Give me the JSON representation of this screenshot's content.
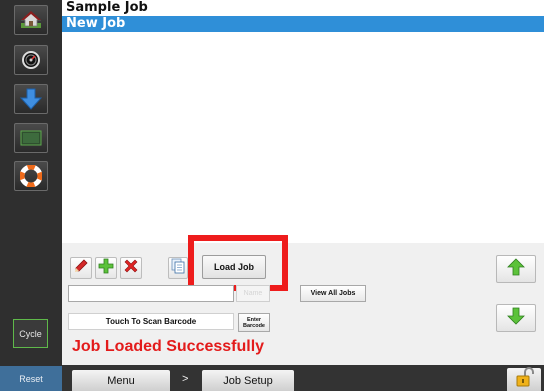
{
  "sidebar": {
    "items": [
      {
        "name": "home",
        "icon": "home-icon"
      },
      {
        "name": "dashboard",
        "icon": "gauge-icon"
      },
      {
        "name": "download",
        "icon": "down-arrow-icon"
      },
      {
        "name": "screen",
        "icon": "monitor-icon"
      },
      {
        "name": "help",
        "icon": "lifebuoy-icon"
      }
    ],
    "cycle_label": "Cycle",
    "reset_label": "Reset"
  },
  "jobs": {
    "items": [
      "Sample Job",
      "New Job"
    ],
    "selected_index": 1
  },
  "toolbar": {
    "edit_icon": "pencil-icon",
    "add_icon": "plus-icon",
    "delete_icon": "x-icon",
    "copy_icon": "copy-icon",
    "load_label": "Load Job"
  },
  "form": {
    "name_value": "",
    "name_button_label": "Name",
    "view_all_label": "View All Jobs",
    "scan_label": "Touch To Scan Barcode",
    "enter_line1": "Enter",
    "enter_line2": "Barcode"
  },
  "status": {
    "message": "Job Loaded Successfully",
    "color": "#e31b1b"
  },
  "nav": {
    "menu_label": "Menu",
    "separator": ">",
    "current_label": "Job Setup"
  },
  "colors": {
    "selection": "#2f8fd8",
    "highlight_box": "#ee1c1c",
    "reset_bg": "#3f6f9a",
    "cycle_border": "#5fb94a"
  }
}
